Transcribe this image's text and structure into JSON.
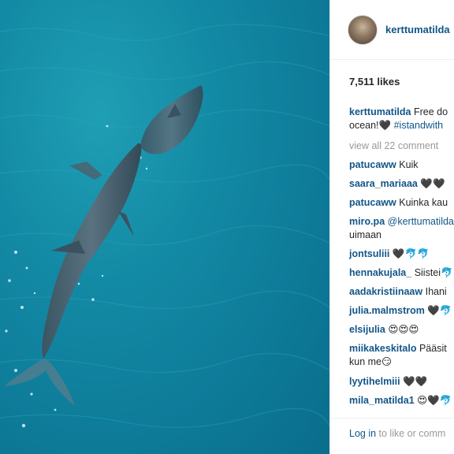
{
  "post": {
    "username": "kerttumatilda",
    "likes": "7,511 likes",
    "caption_user": "kerttumatilda",
    "caption_line1": "Free do",
    "caption_line2_prefix": "ocean!🖤",
    "caption_hashtag": "#istandwith",
    "view_all": "view all 22 comment",
    "comments": [
      {
        "user": "patucaww",
        "text": "Kuik"
      },
      {
        "user": "saara_mariaaa",
        "text": "🖤🖤"
      },
      {
        "user": "patucaww",
        "text": "Kuinka kau"
      },
      {
        "user": "miro.pa",
        "text": "@kerttumatilda",
        "text2": "uimaan"
      },
      {
        "user": "jontsuliii",
        "text": "🖤🐬🐬"
      },
      {
        "user": "hennakujala_",
        "text": "Siistei🐬"
      },
      {
        "user": "aadakristiinaaw",
        "text": "Ihani"
      },
      {
        "user": "julia.malmstrom",
        "text": "🖤🐬"
      },
      {
        "user": "elsijulia",
        "text": "😍😍😍"
      },
      {
        "user": "miikakeskitalo",
        "text": "Pääsit",
        "text2": "kun me😏"
      },
      {
        "user": "lyytihelmiii",
        "text": "🖤🖤"
      },
      {
        "user": "mila_matilda1",
        "text": "😍🖤🐬"
      }
    ],
    "login_link": "Log in",
    "login_rest": " to like or comm"
  },
  "colors": {
    "water": "#138aa5",
    "username": "#125688",
    "muted": "#999999"
  },
  "icons": {
    "dolphin": "dolphin-illustration"
  }
}
